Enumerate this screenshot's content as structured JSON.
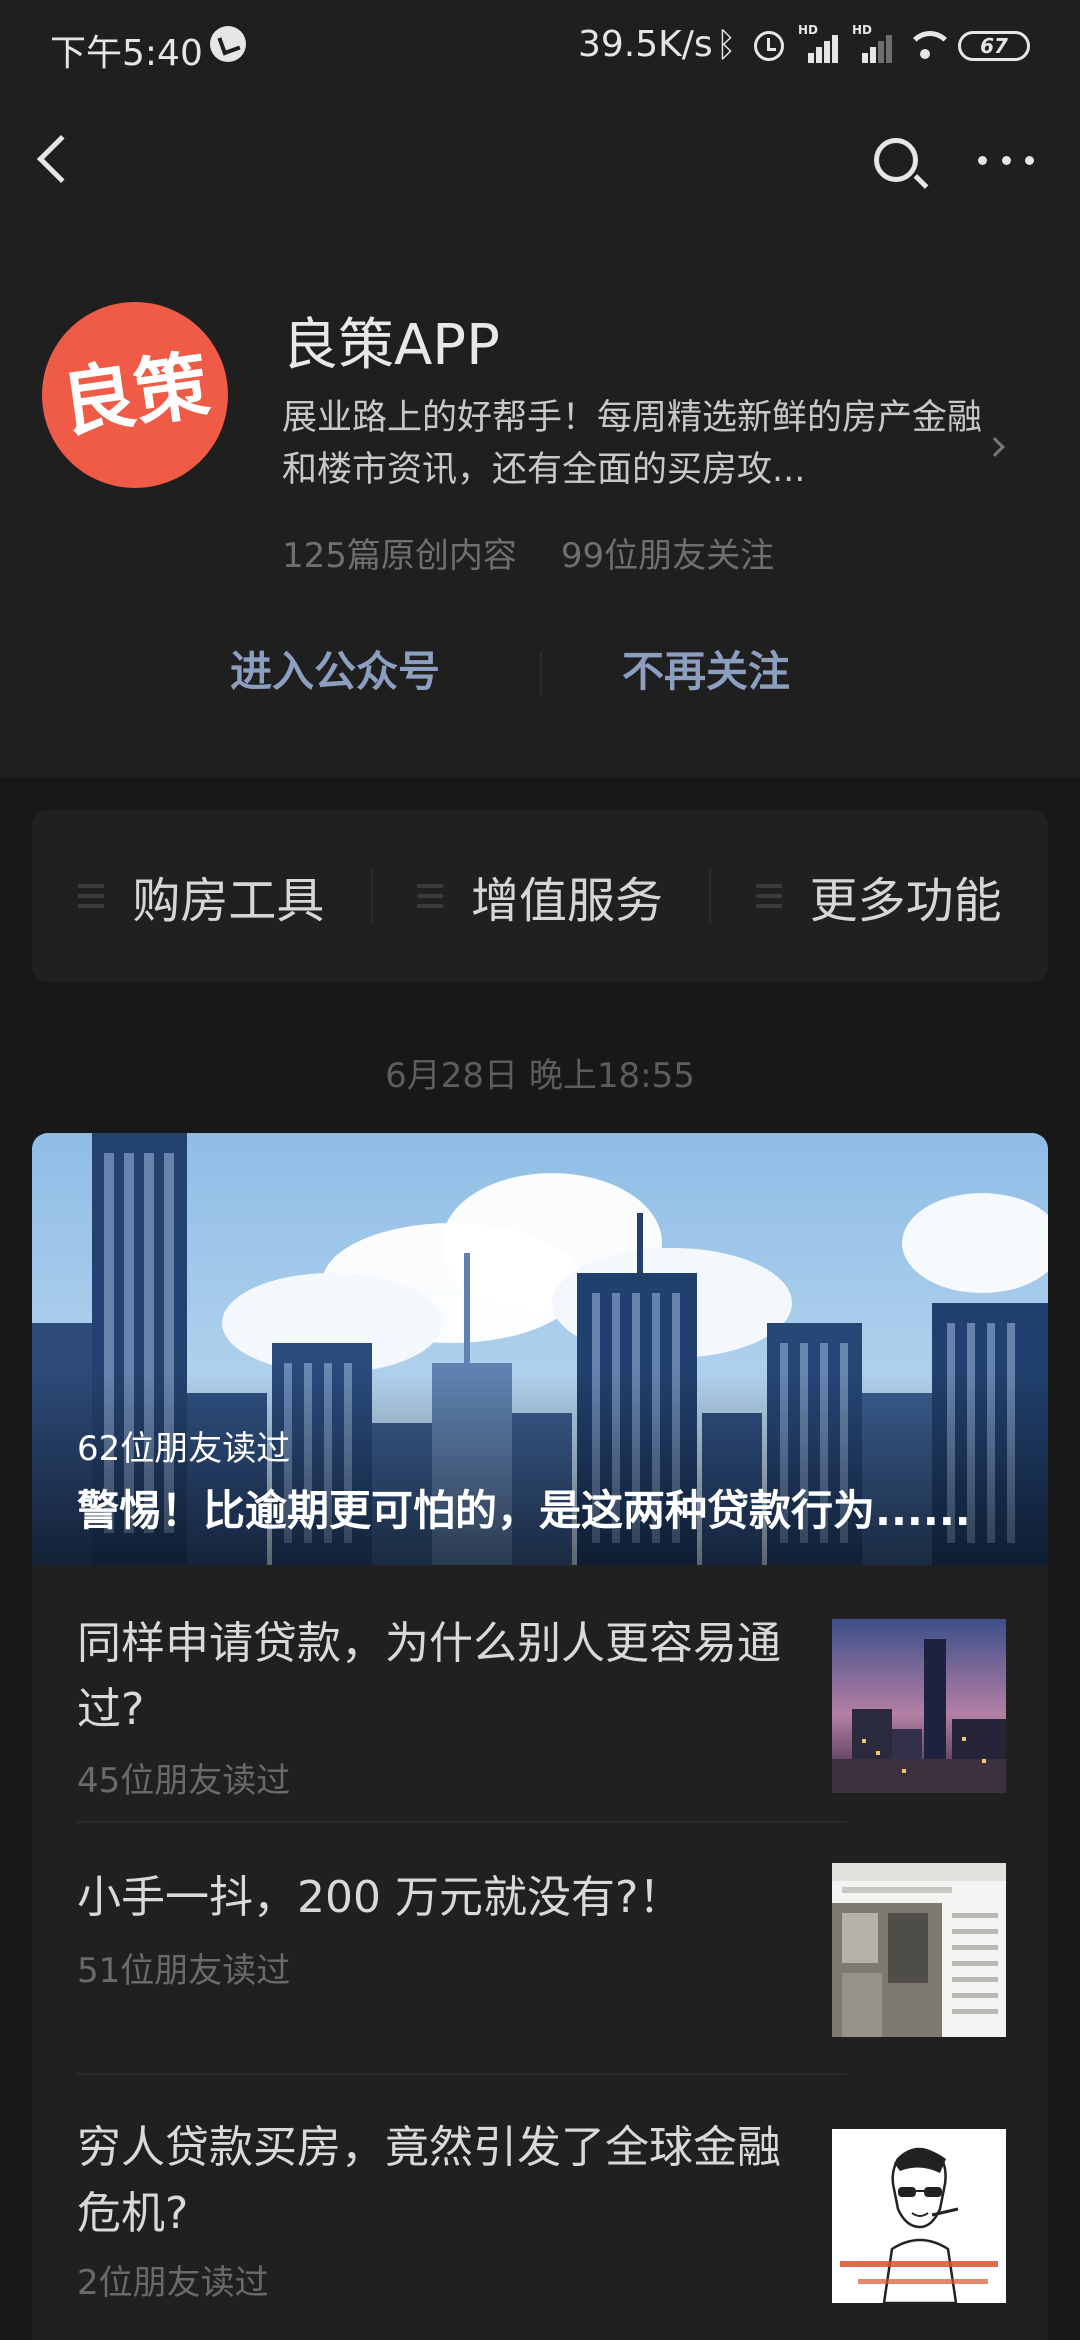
{
  "status_bar": {
    "time": "下午5:40",
    "net_speed": "39.5K/s",
    "battery": "67",
    "signal_label": "HD",
    "icons": [
      "app-notification-icon",
      "bluetooth-icon",
      "alarm-icon",
      "signal-hd-icon",
      "signal-hd-icon",
      "wifi-icon",
      "battery-icon"
    ]
  },
  "nav": {
    "icons": [
      "back-icon",
      "search-icon",
      "more-icon"
    ]
  },
  "profile": {
    "avatar_text": "良策",
    "name": "良策APP",
    "description": "展业路上的好帮手！每周精选新鲜的房产金融和楼市资讯，还有全面的买房攻...",
    "original_count": "125篇原创内容",
    "friends_following": "99位朋友关注",
    "enter_button": "进入公众号",
    "unfollow_button": "不再关注"
  },
  "menu": {
    "items": [
      {
        "label": "购房工具"
      },
      {
        "label": "增值服务"
      },
      {
        "label": "更多功能"
      }
    ]
  },
  "feed": {
    "date": "6月28日 晚上18:55",
    "cover": {
      "reads": "62位朋友读过",
      "title": "警惕！比逾期更可怕的，是这两种贷款行为......"
    },
    "articles": [
      {
        "title": "同样申请贷款，为什么别人更容易通过?",
        "reads": "45位朋友读过"
      },
      {
        "title": "小手一抖，200 万元就没有?！",
        "reads": "51位朋友读过"
      },
      {
        "title": "穷人贷款买房，竟然引发了全球金融危机?",
        "reads": "2位朋友读过"
      }
    ]
  },
  "colors": {
    "background": "#181818",
    "header": "#1f1f1f",
    "accent": "#8c9fc0",
    "avatar": "#ef5b47",
    "sky": "#a6cbea"
  }
}
